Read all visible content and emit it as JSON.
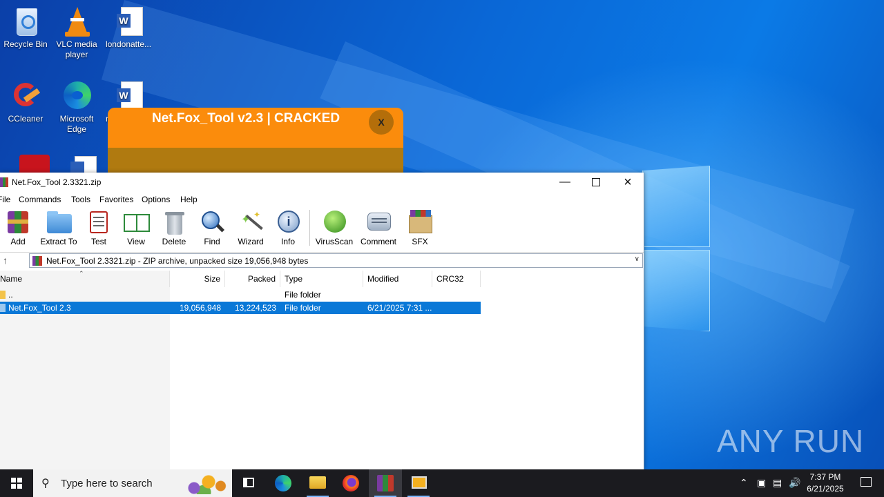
{
  "desktop": {
    "icons": [
      {
        "label": "Recycle Bin",
        "icon": "recycle-bin-icon"
      },
      {
        "label": "VLC media player",
        "icon": "vlc-icon"
      },
      {
        "label": "londonatte...",
        "icon": "word-document-icon"
      },
      {
        "label": "CCleaner",
        "icon": "ccleaner-icon"
      },
      {
        "label": "Microsoft Edge",
        "icon": "edge-icon"
      },
      {
        "label": "m",
        "icon": "word-document-icon"
      },
      {
        "label": "",
        "icon": "acrobat-icon"
      },
      {
        "label": "",
        "icon": "word-document-icon"
      }
    ]
  },
  "popup": {
    "title": "Net.Fox_Tool v2.3  |  CRACKED",
    "close_label": "X",
    "colors": {
      "background": "#fb8c0c",
      "lower": "#b07a10"
    }
  },
  "winrar": {
    "title": "Net.Fox_Tool 2.3321.zip",
    "menu": [
      "File",
      "Commands",
      "Tools",
      "Favorites",
      "Options",
      "Help"
    ],
    "toolbar": [
      {
        "label": "Add",
        "icon": "add-archive-icon"
      },
      {
        "label": "Extract To",
        "icon": "extract-folder-icon"
      },
      {
        "label": "Test",
        "icon": "test-clipboard-icon"
      },
      {
        "label": "View",
        "icon": "view-book-icon"
      },
      {
        "label": "Delete",
        "icon": "trash-icon"
      },
      {
        "label": "Find",
        "icon": "magnifier-icon"
      },
      {
        "label": "Wizard",
        "icon": "wand-icon"
      },
      {
        "label": "Info",
        "icon": "info-icon"
      },
      {
        "label": "VirusScan",
        "icon": "virus-scan-icon"
      },
      {
        "label": "Comment",
        "icon": "comment-icon"
      },
      {
        "label": "SFX",
        "icon": "sfx-box-icon"
      }
    ],
    "address": "Net.Fox_Tool 2.3321.zip - ZIP archive, unpacked size 19,056,948 bytes",
    "columns": [
      "Name",
      "Size",
      "Packed",
      "Type",
      "Modified",
      "CRC32"
    ],
    "rows": [
      {
        "name": "..",
        "size": "",
        "packed": "",
        "type": "File folder",
        "modified": "",
        "crc": ""
      },
      {
        "name": "Net.Fox_Tool 2.3",
        "size": "19,056,948",
        "packed": "13,224,523",
        "type": "File folder",
        "modified": "6/21/2025 7:31 ...",
        "crc": ""
      }
    ],
    "selected_row": 1
  },
  "taskbar": {
    "search_placeholder": "Type here to search",
    "apps": [
      "task-view-icon",
      "edge-icon",
      "file-explorer-icon",
      "firefox-icon",
      "winrar-icon",
      "app-window-icon"
    ],
    "clock_time": "7:37 PM",
    "clock_date": "6/21/2025"
  },
  "watermark": "ANY RUN"
}
